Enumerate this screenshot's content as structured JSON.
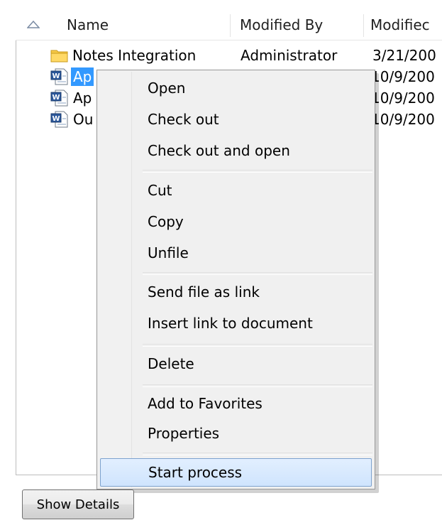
{
  "columns": {
    "name": "Name",
    "modified_by": "Modified By",
    "modified": "Modifiec"
  },
  "rows": [
    {
      "type": "folder",
      "name": "Notes Integration",
      "modified_by": "Administrator",
      "modified": "3/21/200"
    },
    {
      "type": "word-doc",
      "name": "Ap",
      "modified_by": "",
      "modified": "10/9/200",
      "selected": true
    },
    {
      "type": "word-doc",
      "name": "Ap",
      "modified_by": "",
      "modified": "10/9/200"
    },
    {
      "type": "word-doc",
      "name": "Ou",
      "modified_by": "",
      "modified": "10/9/200"
    }
  ],
  "context_menu": {
    "groups": [
      [
        "Open",
        "Check out",
        "Check out and open"
      ],
      [
        "Cut",
        "Copy",
        "Unfile"
      ],
      [
        "Send file as link",
        "Insert link to document"
      ],
      [
        "Delete"
      ],
      [
        "Add to Favorites",
        "Properties"
      ],
      [
        "Start process"
      ]
    ],
    "highlighted_item": "Start process"
  },
  "footer": {
    "show_details_label": "Show Details"
  },
  "colors": {
    "selection": "#3399ff",
    "menu_background": "#f0f0f0",
    "menu_hover_border": "#7da2ce",
    "folder_icon": "#f7c948",
    "word_icon": "#2b579a"
  },
  "icons": {
    "sort": "sort-ascending-arrow-icon",
    "folder": "folder-icon",
    "word": "word-document-icon"
  }
}
